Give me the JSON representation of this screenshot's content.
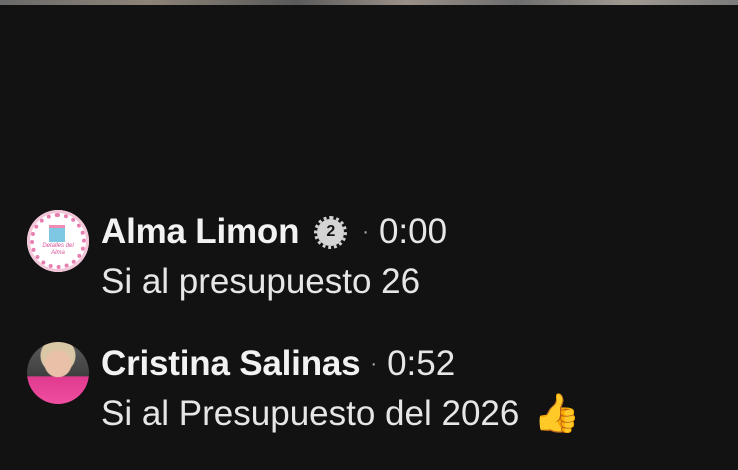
{
  "comments": [
    {
      "name": "Alma Limon",
      "badge": "2",
      "separator": "·",
      "time": "0:00",
      "text": "Si al presupuesto 26",
      "avatar_text": "Detalles del Alma"
    },
    {
      "name": "Cristina Salinas",
      "separator": "·",
      "time": "0:52",
      "text": "Si al Presupuesto del 2026",
      "emoji": "👍"
    }
  ],
  "colors": {
    "background": "#121212",
    "text": "#e6e6e6",
    "badge": "#d4d4d4"
  },
  "icons": {
    "badge_icon": "top-fan-badge-icon",
    "emoji_icon": "thumbs-up-icon"
  }
}
